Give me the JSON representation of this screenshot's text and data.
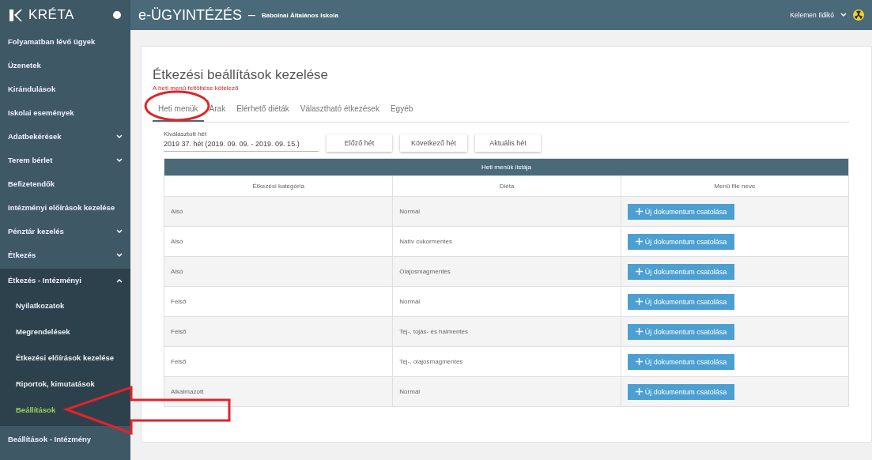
{
  "sidebar": {
    "logo": "KRÉTA",
    "items": [
      {
        "label": "Folyamatban lévő ügyek",
        "kind": "item"
      },
      {
        "label": "Üzenetek",
        "kind": "item"
      },
      {
        "label": "Kirándulások",
        "kind": "item"
      },
      {
        "label": "Iskolai események",
        "kind": "item"
      },
      {
        "label": "Adatbekérések",
        "kind": "group",
        "expanded": false
      },
      {
        "label": "Terem bérlet",
        "kind": "group",
        "expanded": false
      },
      {
        "label": "Befizetendők",
        "kind": "item"
      },
      {
        "label": "Intézményi előírások kezelése",
        "kind": "item"
      },
      {
        "label": "Pénztár kezelés",
        "kind": "group",
        "expanded": false
      },
      {
        "label": "Étkezés",
        "kind": "group",
        "expanded": false
      },
      {
        "label": "Étkezés - Intézményi",
        "kind": "group",
        "expanded": true,
        "children": [
          {
            "label": "Nyilatkozatok",
            "selected": false
          },
          {
            "label": "Megrendelések",
            "selected": false
          },
          {
            "label": "Étkezési előírások kezelése",
            "selected": false
          },
          {
            "label": "Riportok, kimutatások",
            "selected": false
          },
          {
            "label": "Beállítások",
            "selected": true
          }
        ]
      },
      {
        "label": "Beállítások - Intézmény",
        "kind": "item"
      }
    ]
  },
  "header": {
    "title": "e-ÜGYINTÉZÉS",
    "separator": "–",
    "school": "Bábolnai Általános Iskola",
    "user": "Kelemen Ildikó"
  },
  "page": {
    "title": "Étkezési beállítások kezelése",
    "note": "A heti menü feltöltése kötelező",
    "tabs": [
      {
        "label": "Heti menük",
        "selected": true
      },
      {
        "label": "Árak",
        "selected": false
      },
      {
        "label": "Elérhető diéták",
        "selected": false
      },
      {
        "label": "Választható étkezések",
        "selected": false
      },
      {
        "label": "Egyéb",
        "selected": false
      }
    ],
    "week": {
      "label": "Kiválasztott hét",
      "value": "2019 37. hét (2019. 09. 09. - 2019. 09. 15.)"
    },
    "week_buttons": [
      "Előző hét",
      "Következő hét",
      "Aktuális hét"
    ],
    "table": {
      "title": "Heti menük listája",
      "columns": [
        "Étkezési kategória",
        "Diéta",
        "Menü file neve"
      ],
      "rows": [
        {
          "category": "Alsó",
          "diet": "Normál",
          "action": "Új dokumentum csatolása"
        },
        {
          "category": "Alsó",
          "diet": "Natív cukormentes",
          "action": "Új dokumentum csatolása"
        },
        {
          "category": "Alsó",
          "diet": "Olajosmagmentes",
          "action": "Új dokumentum csatolása"
        },
        {
          "category": "Felső",
          "diet": "Normál",
          "action": "Új dokumentum csatolása"
        },
        {
          "category": "Felső",
          "diet": "Tej-, tojás- és halmentes",
          "action": "Új dokumentum csatolása"
        },
        {
          "category": "Felső",
          "diet": "Tej-, olajosmagmentes",
          "action": "Új dokumentum csatolása"
        },
        {
          "category": "Alkalmazott",
          "diet": "Normál",
          "action": "Új dokumentum csatolása"
        }
      ]
    }
  }
}
